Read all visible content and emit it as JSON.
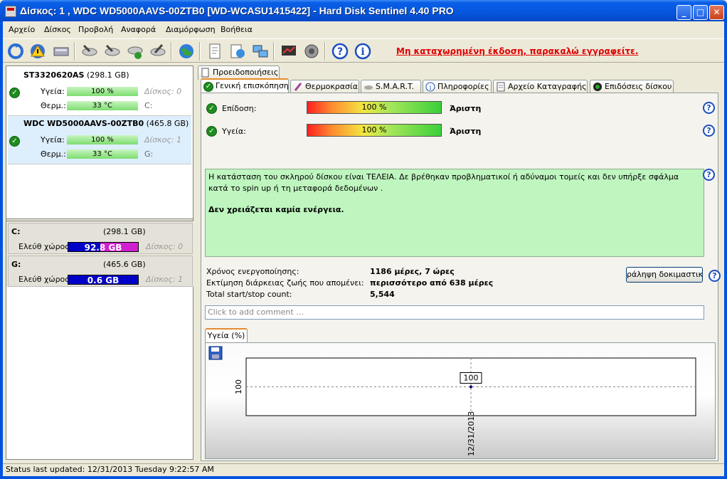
{
  "window": {
    "title": "Δίσκος: 1 , WDC WD5000AAVS-00ZTB0 [WD-WCASU1415422]  -  Hard Disk Sentinel 4.40 PRO",
    "min": "_",
    "max": "□",
    "close": "✕"
  },
  "menu": [
    "Αρχείο",
    "Δίσκος",
    "Προβολή",
    "Αναφορά",
    "Διαμόρφωση",
    "Βοήθεια"
  ],
  "toolbar": {
    "unregistered": "Μη καταχωρημένη έκδοση, παρακαλώ εγγραφείτε."
  },
  "disks": [
    {
      "name": "ST3320620AS",
      "size": "(298.1 GB)",
      "health_label": "Υγεία:",
      "health": "100 %",
      "health_pct": 100,
      "disk_ref": "Δίσκος: 0",
      "temp_label": "Θερμ.:",
      "temp": "33 °C",
      "drive": "C:"
    },
    {
      "name": "WDC WD5000AAVS-00ZTB0",
      "size": "(465.8 GB)",
      "health_label": "Υγεία:",
      "health": "100 %",
      "health_pct": 100,
      "disk_ref": "Δίσκος: 1",
      "temp_label": "Θερμ.:",
      "temp": "33 °C",
      "drive": "G:"
    }
  ],
  "volumes": [
    {
      "letter": "C:",
      "size": "(298.1 GB)",
      "free_label": "Ελεύθ χώρος",
      "free": "92.8 GB",
      "disk_ref": "Δίσκος: 0"
    },
    {
      "letter": "G:",
      "size": "(465.6 GB)",
      "free_label": "Ελεύθ χώρος",
      "free": "0.6 GB",
      "disk_ref": "Δίσκος: 1"
    }
  ],
  "tabs_row1": [
    "Προειδοποιήσεις"
  ],
  "tabs_row2": [
    "Γενική επισκόπηση",
    "Θερμοκρασία",
    "S.M.A.R.T.",
    "Πληροφορίες",
    "Αρχείο Καταγραφής",
    "Επιδόσεις δίσκου"
  ],
  "overview": {
    "perf_label": "Επίδοση:",
    "perf": "100 %",
    "perf_pct": 100,
    "perf_rating": "Άριστη",
    "health_label": "Υγεία:",
    "health": "100 %",
    "health_pct": 100,
    "health_rating": "Άριστη",
    "status_text": "Η κατάσταση του σκληρού δίσκου είναι ΤΕΛΕΙΑ. Δε βρέθηκαν προβληματικοί ή αδύναμοι τομείς και δεν υπήρξε σφάλμα κατά το spin up ή τη μεταφορά δεδομένων .",
    "action_text": "Δεν χρειάζεται καμία ενέργεια.",
    "power_on_label": "Χρόνος ενεργοποίησης:",
    "power_on": "1186 μέρες, 7 ώρες",
    "lifetime_label": "Εκτίμηση διάρκειας ζωής που απομένει:",
    "lifetime": "περισσότερο από 638 μέρες",
    "startstop_label": "Total start/stop count:",
    "startstop": "5,544",
    "test_button": "ράληψη δοκιμαστικού",
    "comment_placeholder": "Click to add comment ..."
  },
  "chart_tab": "Υγεία (%)",
  "chart_data": {
    "type": "line",
    "x": [
      "12/31/2013"
    ],
    "series": [
      {
        "values": [
          100
        ]
      }
    ],
    "ylim": [
      0,
      200
    ],
    "data_labels": [
      "100"
    ],
    "ytick": "100"
  },
  "statusbar": "Status last updated: 12/31/2013 Tuesday 9:22:57 AM"
}
